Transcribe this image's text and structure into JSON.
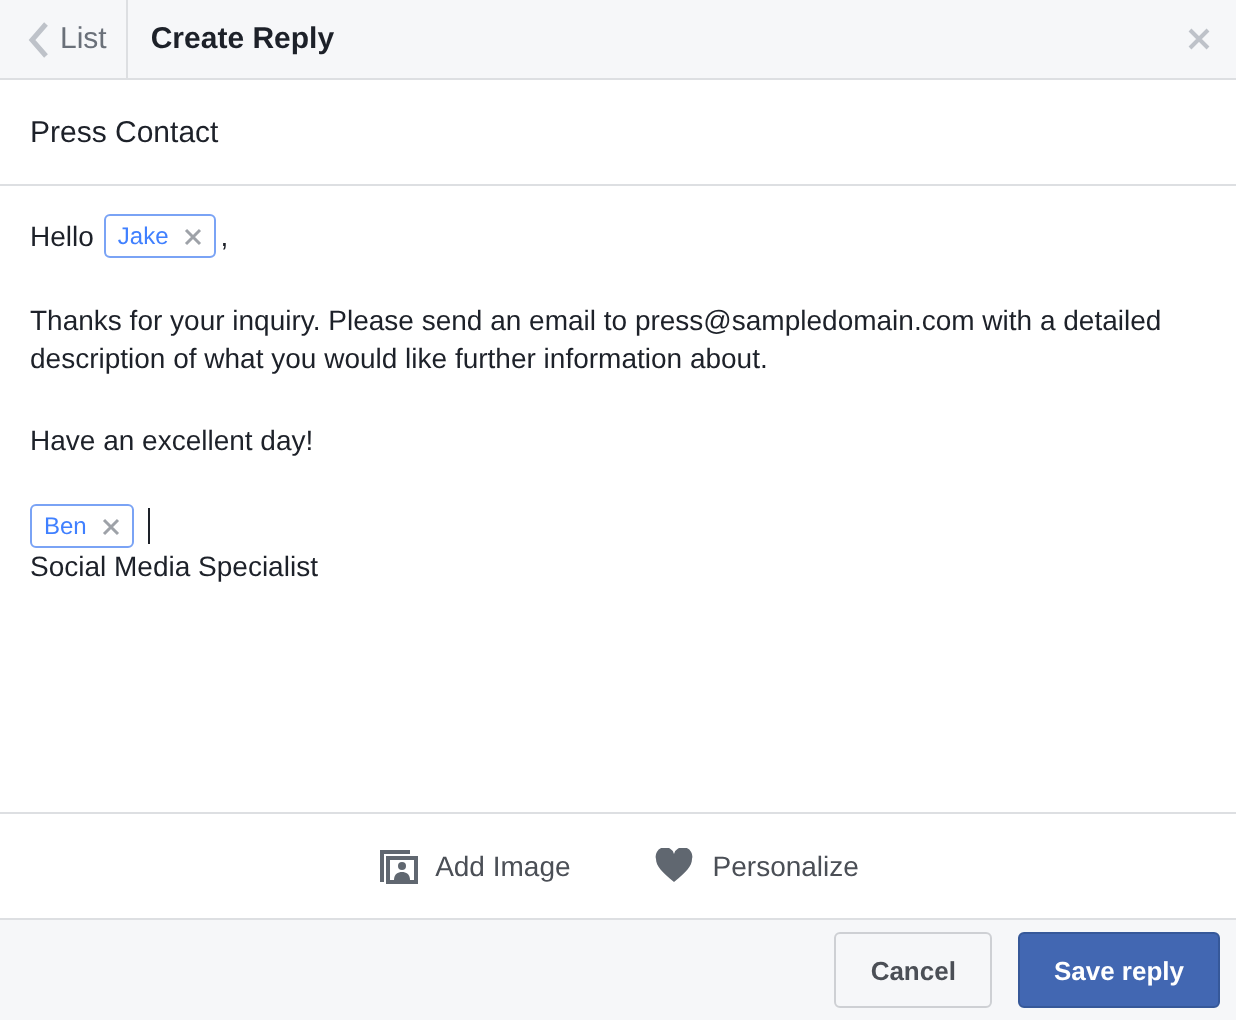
{
  "header": {
    "back_label": "List",
    "title": "Create Reply"
  },
  "reply_name": "Press Contact",
  "message": {
    "greeting": "Hello",
    "greeting_tag": "Jake",
    "greeting_end": ",",
    "paragraphs": [
      "Thanks for your inquiry. Please send an email to press@sampledomain.com with a detailed description of what you would like further information about.",
      "Have an excellent day!"
    ],
    "signature_tag": "Ben",
    "signature_title": "Social Media Specialist"
  },
  "tools": [
    {
      "kind": "image",
      "label": "Add Image"
    },
    {
      "kind": "personalize",
      "label": "Personalize"
    }
  ],
  "buttons": [
    {
      "kind": "secondary",
      "label": "Cancel"
    },
    {
      "kind": "primary",
      "label": "Save reply"
    }
  ]
}
